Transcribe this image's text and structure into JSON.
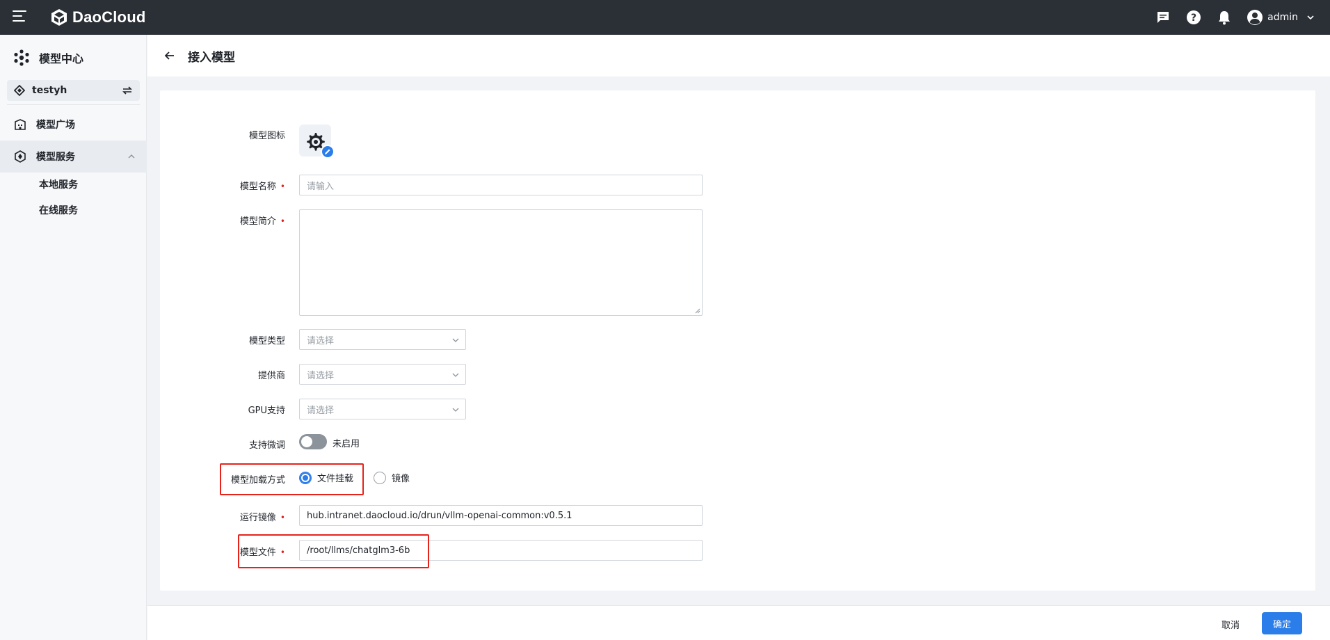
{
  "app": {
    "brand": "DaoCloud",
    "user": "admin"
  },
  "sidebar": {
    "title": "模型中心",
    "workspace": "testyh",
    "items": [
      {
        "label": "模型广场",
        "icon": "building-icon"
      },
      {
        "label": "模型服务",
        "icon": "service-hex-icon",
        "expanded": true,
        "children": [
          {
            "label": "本地服务"
          },
          {
            "label": "在线服务"
          }
        ]
      }
    ]
  },
  "page": {
    "title": "接入模型"
  },
  "form": {
    "icon_label": "模型图标",
    "name_label": "模型名称",
    "name_placeholder": "请输入",
    "desc_label": "模型简介",
    "type_label": "模型类型",
    "type_placeholder": "请选择",
    "provider_label": "提供商",
    "provider_placeholder": "请选择",
    "gpu_label": "GPU支持",
    "gpu_placeholder": "请选择",
    "finetune_label": "支持微调",
    "finetune_state": "未启用",
    "load_label": "模型加载方式",
    "load_options": [
      {
        "label": "文件挂载",
        "selected": true
      },
      {
        "label": "镜像",
        "selected": false
      }
    ],
    "image_label": "运行镜像",
    "image_value": "hub.intranet.daocloud.io/drun/vllm-openai-common:v0.5.1",
    "file_label": "模型文件",
    "file_value": "/root/llms/chatglm3-6b"
  },
  "footer": {
    "cancel": "取消",
    "confirm": "确定"
  },
  "colors": {
    "topbar": "#2b2f36",
    "primary": "#2b7de9",
    "highlight": "#e5231a",
    "required": "#e02020"
  }
}
